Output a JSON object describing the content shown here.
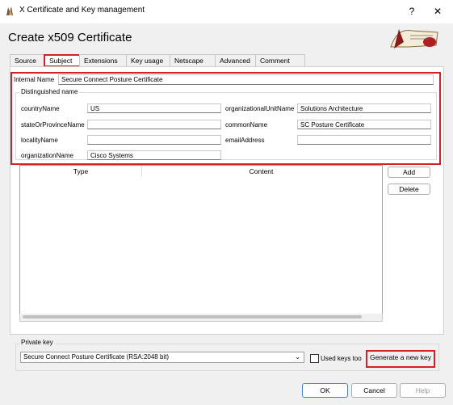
{
  "window": {
    "title": "X Certificate and Key management",
    "help_label": "?",
    "close_label": "✕"
  },
  "heading": "Create x509 Certificate",
  "tabs": [
    {
      "label": "Source"
    },
    {
      "label": "Subject"
    },
    {
      "label": "Extensions"
    },
    {
      "label": "Key usage"
    },
    {
      "label": "Netscape"
    },
    {
      "label": "Advanced"
    },
    {
      "label": "Comment"
    }
  ],
  "subject": {
    "internal_name_label": "Internal Name",
    "internal_name_value": "Secure Connect Posture Certificate",
    "dn_group_label": "Distinguished name",
    "fields": {
      "countryName": {
        "label": "countryName",
        "value": "US"
      },
      "stateOrProvinceName": {
        "label": "stateOrProvinceName",
        "value": ""
      },
      "localityName": {
        "label": "localityName",
        "value": ""
      },
      "organizationName": {
        "label": "organizationName",
        "value": "Cisco Systems"
      },
      "organizationalUnitName": {
        "label": "organizationalUnitName",
        "value": "Solutions Architecture"
      },
      "commonName": {
        "label": "commonName",
        "value": "SC Posture Certificate"
      },
      "emailAddress": {
        "label": "emailAddress",
        "value": ""
      }
    }
  },
  "table": {
    "columns": [
      "Type",
      "Content"
    ],
    "add_label": "Add",
    "delete_label": "Delete"
  },
  "private_key": {
    "group_label": "Private key",
    "selected": "Secure Connect Posture Certificate (RSA:2048 bit)",
    "used_keys_label": "Used keys too",
    "generate_label": "Generate a new key"
  },
  "footer": {
    "ok_label": "OK",
    "cancel_label": "Cancel",
    "help_label": "Help"
  },
  "colors": {
    "highlight": "#d42027"
  }
}
